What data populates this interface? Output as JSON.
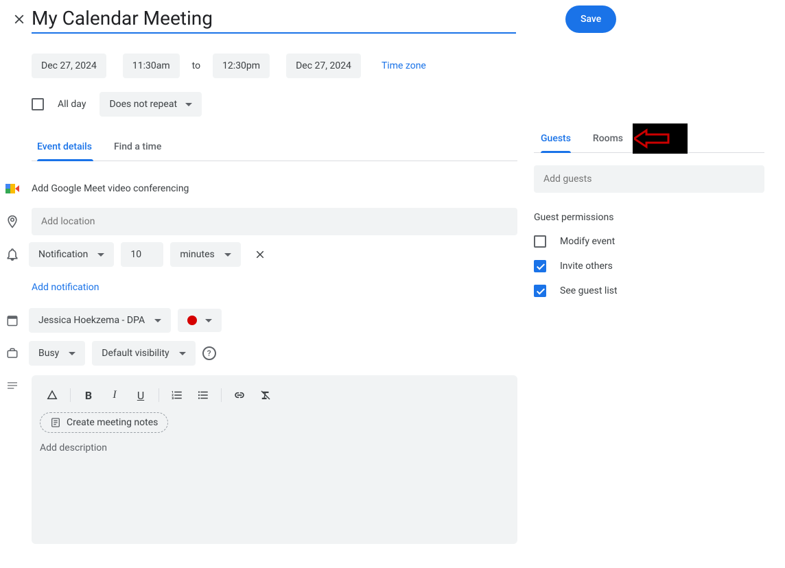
{
  "header": {
    "title": "My Calendar Meeting",
    "save_label": "Save"
  },
  "datetime": {
    "start_date": "Dec 27, 2024",
    "start_time": "11:30am",
    "to": "to",
    "end_time": "12:30pm",
    "end_date": "Dec 27, 2024",
    "timezone_label": "Time zone"
  },
  "allday": {
    "label": "All day",
    "repeat": "Does not repeat"
  },
  "tabs": {
    "details": "Event details",
    "find": "Find a time"
  },
  "meet": {
    "label": "Add Google Meet video conferencing"
  },
  "location": {
    "placeholder": "Add location"
  },
  "notification": {
    "type": "Notification",
    "value": "10",
    "unit": "minutes",
    "add_label": "Add notification"
  },
  "calendar": {
    "owner": "Jessica Hoekzema - DPA"
  },
  "availability": {
    "status": "Busy",
    "visibility": "Default visibility"
  },
  "description": {
    "create_notes": "Create meeting notes",
    "placeholder": "Add description"
  },
  "guests": {
    "tab_guests": "Guests",
    "tab_rooms": "Rooms",
    "input_placeholder": "Add guests",
    "perm_title": "Guest permissions",
    "perm_modify": "Modify event",
    "perm_invite": "Invite others",
    "perm_seelist": "See guest list"
  }
}
